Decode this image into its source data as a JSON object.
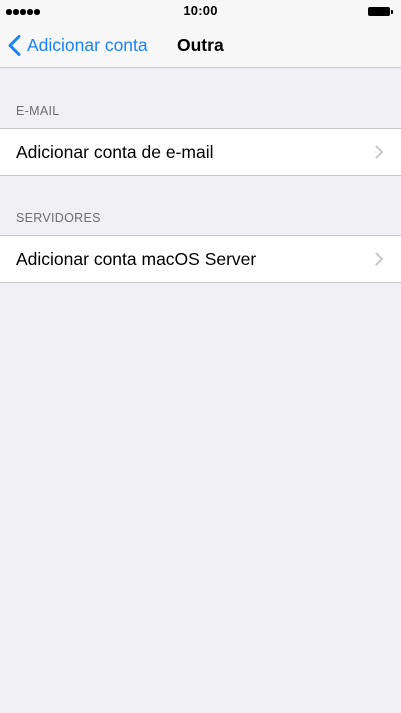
{
  "status_bar": {
    "time": "10:00",
    "signal_icon": "signal-dots-icon",
    "battery_icon": "battery-icon"
  },
  "nav": {
    "back_label": "Adicionar conta",
    "back_icon": "chevron-left-icon",
    "title": "Outra",
    "accent_color": "#1a82fb"
  },
  "sections": [
    {
      "header": "E-MAIL",
      "items": [
        {
          "label": "Adicionar conta de e-mail",
          "icon": "chevron-right-icon"
        }
      ]
    },
    {
      "header": "SERVIDORES",
      "items": [
        {
          "label": "Adicionar conta macOS Server",
          "icon": "chevron-right-icon"
        }
      ]
    }
  ],
  "colors": {
    "background": "#efeff4",
    "separator": "#c8c7cc",
    "section_header": "#6d6d72",
    "chevron": "#c7c7cc"
  }
}
